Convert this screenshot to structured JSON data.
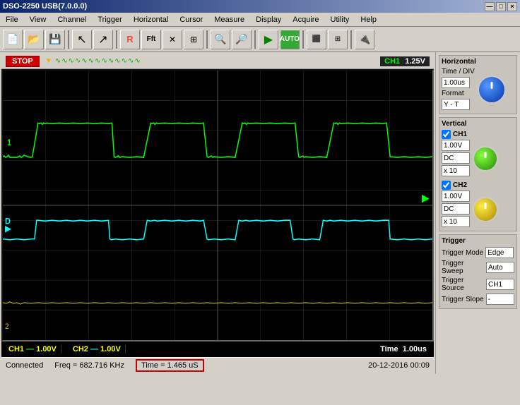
{
  "titleBar": {
    "title": "DSO-2250 USB(7.0.0.0)",
    "buttons": [
      "—",
      "□",
      "×"
    ]
  },
  "menuBar": {
    "items": [
      "File",
      "View",
      "Channel",
      "Trigger",
      "Horizontal",
      "Cursor",
      "Measure",
      "Display",
      "Acquire",
      "Utility",
      "Help"
    ]
  },
  "statusTop": {
    "stop": "STOP",
    "triggerSignal": "∿∿∿∿∿∿∿∿∿∿",
    "ch1Label": "CH1",
    "ch1Voltage": "1.25V"
  },
  "statusBottom": {
    "ch1Label": "CH1",
    "ch1Value": "1.00V",
    "ch2Label": "CH2",
    "ch2Value": "1.00V",
    "timeLabel": "Time",
    "timeValue": "1.00us"
  },
  "infoBar": {
    "connected": "Connected",
    "freq": "Freq = 682.716 KHz",
    "time": "Time = 1.465 uS",
    "date": "20-12-2016  00:09"
  },
  "rightPanel": {
    "horizontal": {
      "title": "Horizontal",
      "timeDivLabel": "Time / DIV",
      "timeDivValue": "1.00us",
      "formatLabel": "Format",
      "formatValue": "Y - T"
    },
    "vertical": {
      "title": "Vertical",
      "ch1": {
        "checked": true,
        "label": "CH1",
        "voltValue": "1.00V",
        "coupling": "DC",
        "probe": "x 10"
      },
      "ch2": {
        "checked": true,
        "label": "CH2",
        "voltValue": "1.00V",
        "coupling": "DC",
        "probe": "x 10"
      }
    },
    "trigger": {
      "title": "Trigger",
      "modeLabel": "Trigger Mode",
      "modeValue": "Edge",
      "sweepLabel": "Trigger Sweep",
      "sweepValue": "Auto",
      "sourceLabel": "Trigger Source",
      "sourceValue": "CH1",
      "slopeLabel": "Trigger Slope",
      "slopeValue": "-"
    }
  },
  "channels": {
    "ch1": {
      "label": "1",
      "color": "#00ff00"
    },
    "ch2": {
      "label": "D",
      "color": "#00ffff"
    },
    "ch3": {
      "label": "2",
      "color": "#cccc00"
    }
  }
}
